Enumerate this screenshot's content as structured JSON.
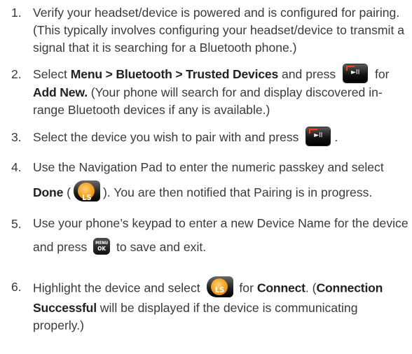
{
  "steps": [
    {
      "num": "1.",
      "text": "Verify your headset/device is powered and is configured for pairing. (This typically involves configuring your headset/device to transmit a signal that it is searching for a Bluetooth phone.)"
    },
    {
      "num": "2.",
      "a": "Select ",
      "b_path": "Menu > Bluetooth > Trusted Devices",
      "c": " and press ",
      "d": " for ",
      "e_bold": "Add New.",
      "f": " (Your phone will search for and display discovered in-range Bluetooth devices if any is available.)"
    },
    {
      "num": "3.",
      "a": "Select the device you wish to pair with and press ",
      "b": "."
    },
    {
      "num": "4.",
      "a": "Use the Navigation Pad to enter the numeric passkey and select ",
      "b_bold": "Done",
      "c": " (",
      "d": "). You are then notified that Pairing is in progress."
    },
    {
      "num": "5.",
      "a": "Use your phone’s keypad to enter a new Device Name for the device and press ",
      "b": " to save and exit."
    },
    {
      "num": "6.",
      "a": "Highlight the device and select ",
      "b": " for ",
      "c_bold": "Connect",
      "d": ". (",
      "e_bold": "Connection Successful",
      "f": " will be displayed if the device is communicating properly.)"
    }
  ],
  "icons": {
    "play_pause": {
      "name": "play-pause-key-icon",
      "glyph": "►II"
    },
    "left_softkey": {
      "name": "left-softkey-icon",
      "label": "LS",
      "color": "#f49a15"
    },
    "menu_ok": {
      "name": "menu-ok-key-icon",
      "line1": "MENU",
      "line2": "OK"
    }
  }
}
